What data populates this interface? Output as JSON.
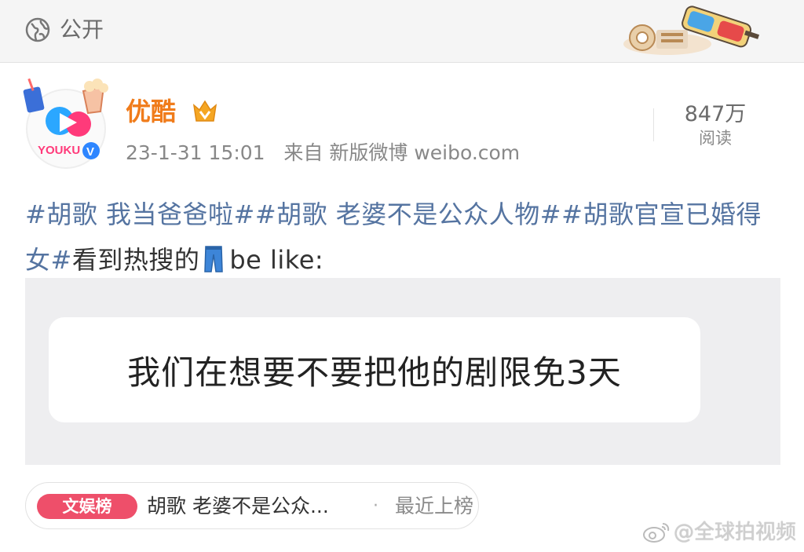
{
  "topbar": {
    "visibility_label": "公开",
    "visibility_icon": "globe-icon"
  },
  "post": {
    "author": "优酷",
    "avatar_text": "YOUKU",
    "verified_badge": "V",
    "date": "23-1-31 15:01",
    "source": "来自 新版微博 weibo.com",
    "views_count": "847万",
    "views_label": "阅读",
    "hashtags": [
      "#胡歌 我当爸爸啦#",
      "#胡歌 老婆不是公众人物#",
      "#胡歌官宣已婚得女#"
    ],
    "body_text": "看到热搜的",
    "body_suffix": "be like:",
    "emoji": "jeans-emoji"
  },
  "media": {
    "bubble_text": "我们在想要不要把他的剧限免3天"
  },
  "trend": {
    "badge": "文娱榜",
    "title": "胡歌 老婆不是公众...",
    "dot": "·",
    "status": "最近上榜"
  },
  "watermark": {
    "text": "@全球拍视频"
  },
  "colors": {
    "author": "#f07c1b",
    "hashtag": "#5574a1",
    "trend_badge": "#ee4f6a"
  }
}
